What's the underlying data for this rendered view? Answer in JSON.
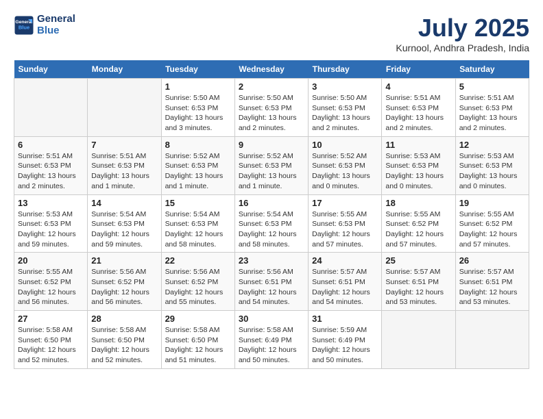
{
  "header": {
    "logo_line1": "General",
    "logo_line2": "Blue",
    "month_year": "July 2025",
    "location": "Kurnool, Andhra Pradesh, India"
  },
  "days_of_week": [
    "Sunday",
    "Monday",
    "Tuesday",
    "Wednesday",
    "Thursday",
    "Friday",
    "Saturday"
  ],
  "weeks": [
    [
      {
        "day": "",
        "empty": true
      },
      {
        "day": "",
        "empty": true
      },
      {
        "day": "1",
        "sunrise": "5:50 AM",
        "sunset": "6:53 PM",
        "daylight": "13 hours and 3 minutes."
      },
      {
        "day": "2",
        "sunrise": "5:50 AM",
        "sunset": "6:53 PM",
        "daylight": "13 hours and 2 minutes."
      },
      {
        "day": "3",
        "sunrise": "5:50 AM",
        "sunset": "6:53 PM",
        "daylight": "13 hours and 2 minutes."
      },
      {
        "day": "4",
        "sunrise": "5:51 AM",
        "sunset": "6:53 PM",
        "daylight": "13 hours and 2 minutes."
      },
      {
        "day": "5",
        "sunrise": "5:51 AM",
        "sunset": "6:53 PM",
        "daylight": "13 hours and 2 minutes."
      }
    ],
    [
      {
        "day": "6",
        "sunrise": "5:51 AM",
        "sunset": "6:53 PM",
        "daylight": "13 hours and 2 minutes."
      },
      {
        "day": "7",
        "sunrise": "5:51 AM",
        "sunset": "6:53 PM",
        "daylight": "13 hours and 1 minute."
      },
      {
        "day": "8",
        "sunrise": "5:52 AM",
        "sunset": "6:53 PM",
        "daylight": "13 hours and 1 minute."
      },
      {
        "day": "9",
        "sunrise": "5:52 AM",
        "sunset": "6:53 PM",
        "daylight": "13 hours and 1 minute."
      },
      {
        "day": "10",
        "sunrise": "5:52 AM",
        "sunset": "6:53 PM",
        "daylight": "13 hours and 0 minutes."
      },
      {
        "day": "11",
        "sunrise": "5:53 AM",
        "sunset": "6:53 PM",
        "daylight": "13 hours and 0 minutes."
      },
      {
        "day": "12",
        "sunrise": "5:53 AM",
        "sunset": "6:53 PM",
        "daylight": "13 hours and 0 minutes."
      }
    ],
    [
      {
        "day": "13",
        "sunrise": "5:53 AM",
        "sunset": "6:53 PM",
        "daylight": "12 hours and 59 minutes."
      },
      {
        "day": "14",
        "sunrise": "5:54 AM",
        "sunset": "6:53 PM",
        "daylight": "12 hours and 59 minutes."
      },
      {
        "day": "15",
        "sunrise": "5:54 AM",
        "sunset": "6:53 PM",
        "daylight": "12 hours and 58 minutes."
      },
      {
        "day": "16",
        "sunrise": "5:54 AM",
        "sunset": "6:53 PM",
        "daylight": "12 hours and 58 minutes."
      },
      {
        "day": "17",
        "sunrise": "5:55 AM",
        "sunset": "6:53 PM",
        "daylight": "12 hours and 57 minutes."
      },
      {
        "day": "18",
        "sunrise": "5:55 AM",
        "sunset": "6:52 PM",
        "daylight": "12 hours and 57 minutes."
      },
      {
        "day": "19",
        "sunrise": "5:55 AM",
        "sunset": "6:52 PM",
        "daylight": "12 hours and 57 minutes."
      }
    ],
    [
      {
        "day": "20",
        "sunrise": "5:55 AM",
        "sunset": "6:52 PM",
        "daylight": "12 hours and 56 minutes."
      },
      {
        "day": "21",
        "sunrise": "5:56 AM",
        "sunset": "6:52 PM",
        "daylight": "12 hours and 56 minutes."
      },
      {
        "day": "22",
        "sunrise": "5:56 AM",
        "sunset": "6:52 PM",
        "daylight": "12 hours and 55 minutes."
      },
      {
        "day": "23",
        "sunrise": "5:56 AM",
        "sunset": "6:51 PM",
        "daylight": "12 hours and 54 minutes."
      },
      {
        "day": "24",
        "sunrise": "5:57 AM",
        "sunset": "6:51 PM",
        "daylight": "12 hours and 54 minutes."
      },
      {
        "day": "25",
        "sunrise": "5:57 AM",
        "sunset": "6:51 PM",
        "daylight": "12 hours and 53 minutes."
      },
      {
        "day": "26",
        "sunrise": "5:57 AM",
        "sunset": "6:51 PM",
        "daylight": "12 hours and 53 minutes."
      }
    ],
    [
      {
        "day": "27",
        "sunrise": "5:58 AM",
        "sunset": "6:50 PM",
        "daylight": "12 hours and 52 minutes."
      },
      {
        "day": "28",
        "sunrise": "5:58 AM",
        "sunset": "6:50 PM",
        "daylight": "12 hours and 52 minutes."
      },
      {
        "day": "29",
        "sunrise": "5:58 AM",
        "sunset": "6:50 PM",
        "daylight": "12 hours and 51 minutes."
      },
      {
        "day": "30",
        "sunrise": "5:58 AM",
        "sunset": "6:49 PM",
        "daylight": "12 hours and 50 minutes."
      },
      {
        "day": "31",
        "sunrise": "5:59 AM",
        "sunset": "6:49 PM",
        "daylight": "12 hours and 50 minutes."
      },
      {
        "day": "",
        "empty": true
      },
      {
        "day": "",
        "empty": true
      }
    ]
  ],
  "labels": {
    "sunrise_prefix": "Sunrise: ",
    "sunset_prefix": "Sunset: ",
    "daylight_prefix": "Daylight: "
  }
}
